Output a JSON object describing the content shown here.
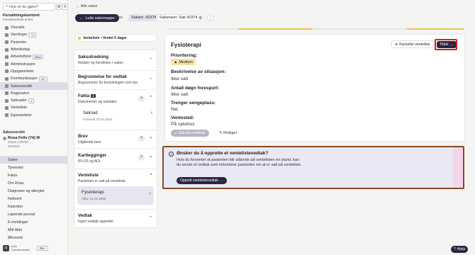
{
  "sidebar": {
    "search_placeholder": "Hva vil du gjøre?",
    "shortcut_cmd": "⌘",
    "shortcut_k": "K",
    "org_name": "Forvaltningskontoret",
    "org_sub": "Koordinerende enhet",
    "items": [
      {
        "label": "Oversikt"
      },
      {
        "label": "Varslinger",
        "badge": "74"
      },
      {
        "label": "Pasienter"
      },
      {
        "label": "Arbeidsdag"
      },
      {
        "label": "Arbeidsflyter",
        "badge": "Beta"
      },
      {
        "label": "Administrasjon"
      },
      {
        "label": "Oppgavelister"
      },
      {
        "label": "Kommunikasjon",
        "badge": "99+"
      },
      {
        "label": "Saksoversikt"
      },
      {
        "label": "Klagesaker"
      },
      {
        "label": "Søknader",
        "badge": "4"
      },
      {
        "label": "Venteliste"
      },
      {
        "label": "Egenandeler"
      }
    ],
    "case_heading": "Saksoversikt",
    "patient_name": "Rosa Felle (74) M",
    "patient_meta1": "23045 1 89753",
    "patient_meta2": "2516922",
    "case_items": [
      {
        "label": "Saker"
      },
      {
        "label": "Tjenester"
      },
      {
        "label": "Fakta"
      },
      {
        "label": "Om Rosa"
      },
      {
        "label": "Diagnoser og allergier"
      },
      {
        "label": "Nettverk"
      },
      {
        "label": "Kalender"
      },
      {
        "label": "Løpende journal"
      },
      {
        "label": "E-meldinger"
      },
      {
        "label": "Mitt Aidn"
      },
      {
        "label": "Økonomi"
      }
    ],
    "footer_logo": "a",
    "footer_line1": "Aidn",
    "footer_line2": "Saksbehandler",
    "env": "Dev"
  },
  "top": {
    "back": "Alle saker",
    "close_case": "Lukk saksmappe",
    "status": "Åpen",
    "chip1": "Saksnr: 41974",
    "chip2": "Saksnavn: Sak 41974"
  },
  "left": {
    "venteliste_bar": "Venteliste • Ventet 0 dager",
    "sections": {
      "saksutredning": {
        "title": "Saksutredning",
        "desc": "Notater og hendelser i saken"
      },
      "begrunnelse": {
        "title": "Begrunnelse for vedtak",
        "desc": "Begrunnelse for beslutningen som tas"
      },
      "fakta": {
        "title": "Fakta",
        "count": "1",
        "desc": "Dokumenter og samtaler"
      },
      "soknad": {
        "title": "Søknad",
        "meta": "Innsendt 20.04.2026"
      },
      "brev": {
        "title": "Brev",
        "desc": "Utgående brev"
      },
      "kartlegginger": {
        "title": "Kartlegginger",
        "desc": "IPLOS og ADL"
      },
      "venteliste": {
        "title": "Venteliste",
        "desc": "Pasienten er satt på venteliste"
      },
      "fysio_card": {
        "title": "Fysioterapi",
        "meta": "Aktiv, 21.04.2026"
      },
      "vedtak": {
        "title": "Vedtak",
        "desc": "Ingen vedtak opprettet"
      }
    }
  },
  "panel": {
    "title": "Fysioterapi",
    "cancel_label": "Kanseller venteliste",
    "assign_label": "Tildel",
    "priority_label": "Prioritering:",
    "priority_value": "Medium",
    "situation_label": "Beskrivelse av situasjon:",
    "situation_value": "Ikke satt",
    "hours_label": "Antall døgn forespurt:",
    "hours_value": "Ikke satt",
    "bed_label": "Trenger sengeplass:",
    "bed_value": "Nei",
    "waiting_label": "Ventested:",
    "waiting_value": "På sykehus",
    "set_button": "Satt på venteliste",
    "edit_label": "Rediger"
  },
  "alert": {
    "title": "Ønsker du å opprette et ventelistevedtak?",
    "desc": "Hvis du forventer at pasienten blir stående på ventelisten en stund, kan du sende et vedtak som informerer pasienten om at er satt på venteliste.",
    "button": "Opprett ventelistevedtak"
  },
  "help": "Hjelp",
  "colors": {
    "primary": "#2c2440",
    "accent": "#f0c24a",
    "highlight": "#d81e1e"
  }
}
